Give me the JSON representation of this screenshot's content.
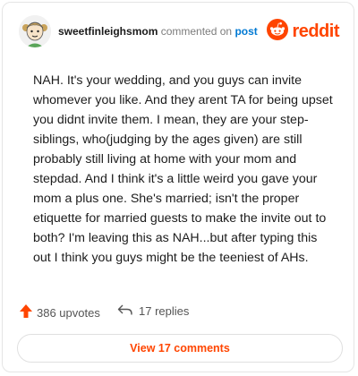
{
  "header": {
    "username": "sweetfinleighsmom",
    "action": "commented on",
    "target": "post",
    "brand": "reddit"
  },
  "icons": {
    "avatar": "avatar-icon",
    "brand": "reddit-alien-icon",
    "upvote": "upvote-arrow-icon",
    "reply": "reply-arrow-icon"
  },
  "comment": {
    "text": "NAH. It's your wedding, and you guys can invite whomever you like. And they arent TA for being upset you didnt invite them. I mean, they are your step-siblings, who(judging by the ages given) are still probably still living at home with your mom and stepdad. And I think it's a little weird you gave your mom a plus one. She's married; isn't the proper etiquette for married guests to make the invite out to both? I'm leaving this as NAH...but after typing this out I think you guys might be the teeniest of AHs."
  },
  "footer": {
    "upvotes": "386 upvotes",
    "replies": "17 replies",
    "view_button": "View 17 comments"
  },
  "colors": {
    "brand": "#ff4500",
    "link": "#0079d3",
    "text": "#1c1c1c",
    "muted": "#7c7c7c"
  }
}
